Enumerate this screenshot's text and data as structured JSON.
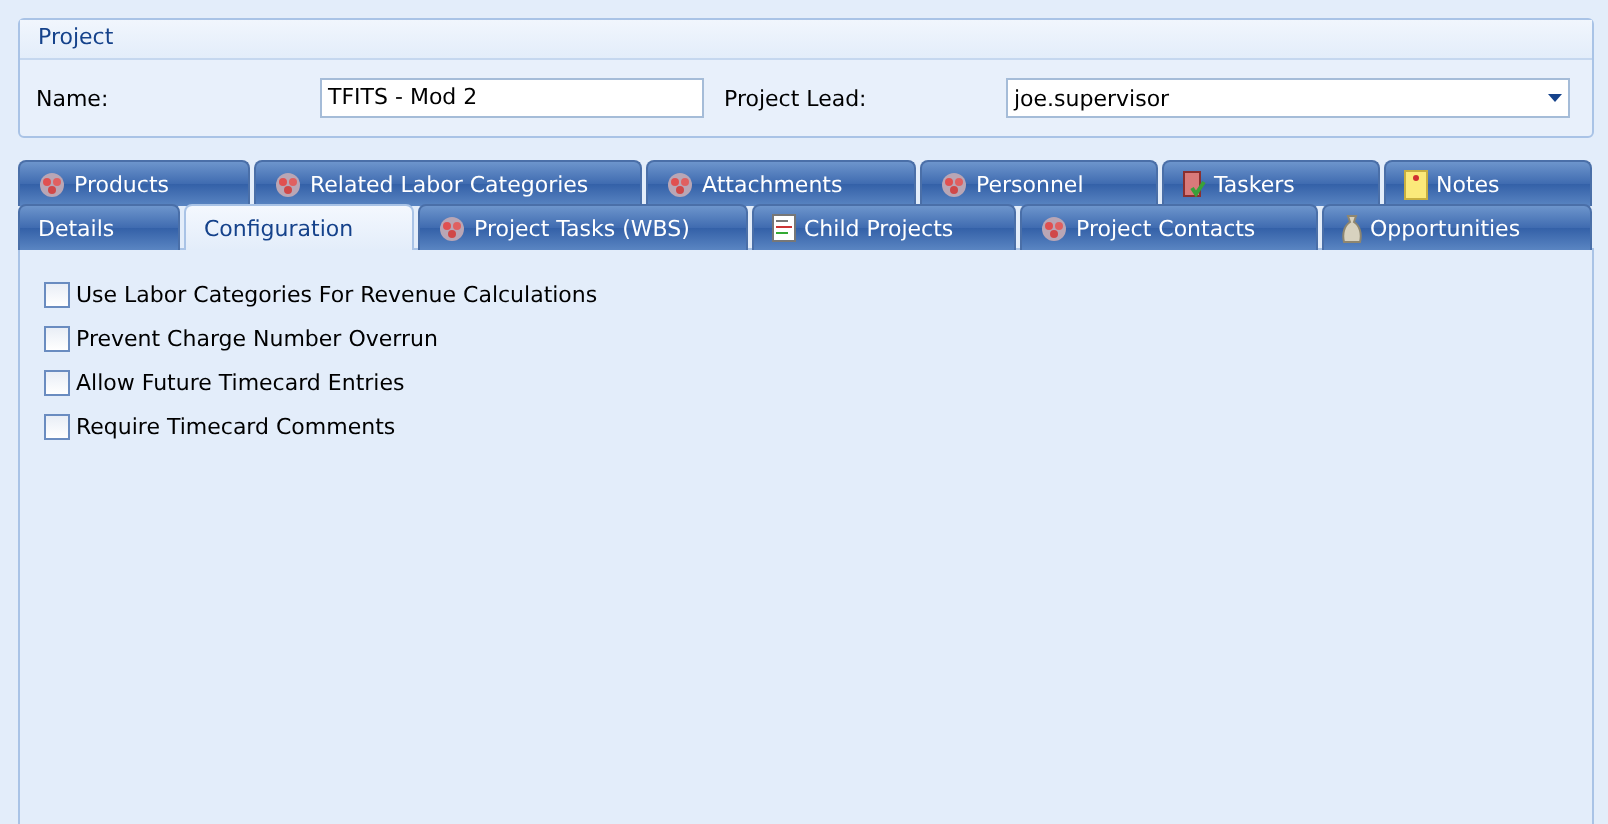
{
  "project": {
    "title": "Project",
    "name_label": "Name:",
    "name_value": "TFITS - Mod 2",
    "lead_label": "Project Lead:",
    "lead_value": "joe.supervisor"
  },
  "tab_rows": [
    [
      {
        "label": "Products",
        "kind": "group",
        "selected": false
      },
      {
        "label": "Related Labor Categories",
        "kind": "group",
        "selected": false
      },
      {
        "label": "Attachments",
        "kind": "group",
        "selected": false
      },
      {
        "label": "Personnel",
        "kind": "group",
        "selected": false
      },
      {
        "label": "Taskers",
        "kind": "clipboard",
        "selected": false
      },
      {
        "label": "Notes",
        "kind": "note",
        "selected": false
      }
    ],
    [
      {
        "label": "Details",
        "kind": "plain",
        "selected": false
      },
      {
        "label": "Configuration",
        "kind": "plain",
        "selected": true
      },
      {
        "label": "Project Tasks (WBS)",
        "kind": "group",
        "selected": false
      },
      {
        "label": "Child Projects",
        "kind": "document",
        "selected": false
      },
      {
        "label": "Project Contacts",
        "kind": "group",
        "selected": false
      },
      {
        "label": "Opportunities",
        "kind": "moneybag",
        "selected": false
      }
    ]
  ],
  "options": [
    {
      "label": "Use Labor Categories For Revenue Calculations",
      "checked": false
    },
    {
      "label": "Prevent Charge Number Overrun",
      "checked": false
    },
    {
      "label": "Allow Future Timecard Entries",
      "checked": false
    },
    {
      "label": "Require Timecard Comments",
      "checked": false
    }
  ]
}
